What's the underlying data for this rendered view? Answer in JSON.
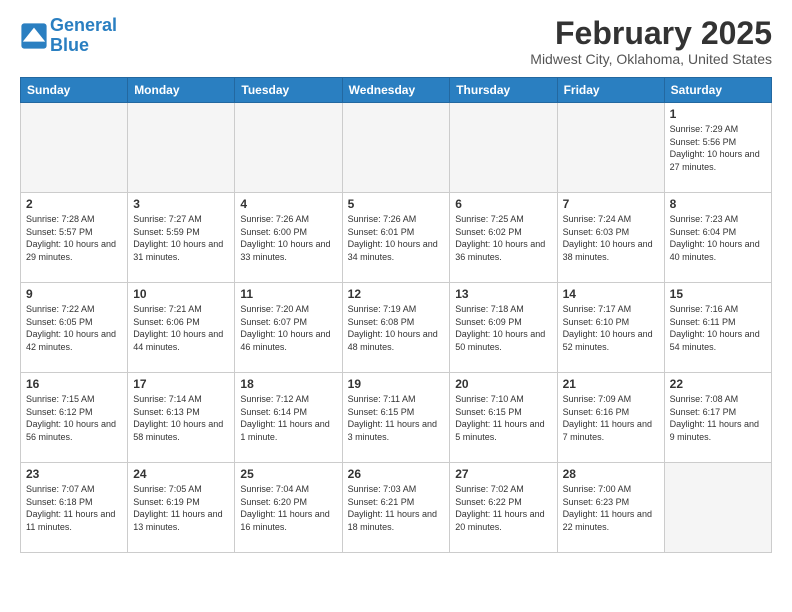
{
  "header": {
    "logo_line1": "General",
    "logo_line2": "Blue",
    "month_title": "February 2025",
    "location": "Midwest City, Oklahoma, United States"
  },
  "days_of_week": [
    "Sunday",
    "Monday",
    "Tuesday",
    "Wednesday",
    "Thursday",
    "Friday",
    "Saturday"
  ],
  "weeks": [
    [
      {
        "num": "",
        "info": ""
      },
      {
        "num": "",
        "info": ""
      },
      {
        "num": "",
        "info": ""
      },
      {
        "num": "",
        "info": ""
      },
      {
        "num": "",
        "info": ""
      },
      {
        "num": "",
        "info": ""
      },
      {
        "num": "1",
        "info": "Sunrise: 7:29 AM\nSunset: 5:56 PM\nDaylight: 10 hours and 27 minutes."
      }
    ],
    [
      {
        "num": "2",
        "info": "Sunrise: 7:28 AM\nSunset: 5:57 PM\nDaylight: 10 hours and 29 minutes."
      },
      {
        "num": "3",
        "info": "Sunrise: 7:27 AM\nSunset: 5:59 PM\nDaylight: 10 hours and 31 minutes."
      },
      {
        "num": "4",
        "info": "Sunrise: 7:26 AM\nSunset: 6:00 PM\nDaylight: 10 hours and 33 minutes."
      },
      {
        "num": "5",
        "info": "Sunrise: 7:26 AM\nSunset: 6:01 PM\nDaylight: 10 hours and 34 minutes."
      },
      {
        "num": "6",
        "info": "Sunrise: 7:25 AM\nSunset: 6:02 PM\nDaylight: 10 hours and 36 minutes."
      },
      {
        "num": "7",
        "info": "Sunrise: 7:24 AM\nSunset: 6:03 PM\nDaylight: 10 hours and 38 minutes."
      },
      {
        "num": "8",
        "info": "Sunrise: 7:23 AM\nSunset: 6:04 PM\nDaylight: 10 hours and 40 minutes."
      }
    ],
    [
      {
        "num": "9",
        "info": "Sunrise: 7:22 AM\nSunset: 6:05 PM\nDaylight: 10 hours and 42 minutes."
      },
      {
        "num": "10",
        "info": "Sunrise: 7:21 AM\nSunset: 6:06 PM\nDaylight: 10 hours and 44 minutes."
      },
      {
        "num": "11",
        "info": "Sunrise: 7:20 AM\nSunset: 6:07 PM\nDaylight: 10 hours and 46 minutes."
      },
      {
        "num": "12",
        "info": "Sunrise: 7:19 AM\nSunset: 6:08 PM\nDaylight: 10 hours and 48 minutes."
      },
      {
        "num": "13",
        "info": "Sunrise: 7:18 AM\nSunset: 6:09 PM\nDaylight: 10 hours and 50 minutes."
      },
      {
        "num": "14",
        "info": "Sunrise: 7:17 AM\nSunset: 6:10 PM\nDaylight: 10 hours and 52 minutes."
      },
      {
        "num": "15",
        "info": "Sunrise: 7:16 AM\nSunset: 6:11 PM\nDaylight: 10 hours and 54 minutes."
      }
    ],
    [
      {
        "num": "16",
        "info": "Sunrise: 7:15 AM\nSunset: 6:12 PM\nDaylight: 10 hours and 56 minutes."
      },
      {
        "num": "17",
        "info": "Sunrise: 7:14 AM\nSunset: 6:13 PM\nDaylight: 10 hours and 58 minutes."
      },
      {
        "num": "18",
        "info": "Sunrise: 7:12 AM\nSunset: 6:14 PM\nDaylight: 11 hours and 1 minute."
      },
      {
        "num": "19",
        "info": "Sunrise: 7:11 AM\nSunset: 6:15 PM\nDaylight: 11 hours and 3 minutes."
      },
      {
        "num": "20",
        "info": "Sunrise: 7:10 AM\nSunset: 6:15 PM\nDaylight: 11 hours and 5 minutes."
      },
      {
        "num": "21",
        "info": "Sunrise: 7:09 AM\nSunset: 6:16 PM\nDaylight: 11 hours and 7 minutes."
      },
      {
        "num": "22",
        "info": "Sunrise: 7:08 AM\nSunset: 6:17 PM\nDaylight: 11 hours and 9 minutes."
      }
    ],
    [
      {
        "num": "23",
        "info": "Sunrise: 7:07 AM\nSunset: 6:18 PM\nDaylight: 11 hours and 11 minutes."
      },
      {
        "num": "24",
        "info": "Sunrise: 7:05 AM\nSunset: 6:19 PM\nDaylight: 11 hours and 13 minutes."
      },
      {
        "num": "25",
        "info": "Sunrise: 7:04 AM\nSunset: 6:20 PM\nDaylight: 11 hours and 16 minutes."
      },
      {
        "num": "26",
        "info": "Sunrise: 7:03 AM\nSunset: 6:21 PM\nDaylight: 11 hours and 18 minutes."
      },
      {
        "num": "27",
        "info": "Sunrise: 7:02 AM\nSunset: 6:22 PM\nDaylight: 11 hours and 20 minutes."
      },
      {
        "num": "28",
        "info": "Sunrise: 7:00 AM\nSunset: 6:23 PM\nDaylight: 11 hours and 22 minutes."
      },
      {
        "num": "",
        "info": ""
      }
    ]
  ]
}
